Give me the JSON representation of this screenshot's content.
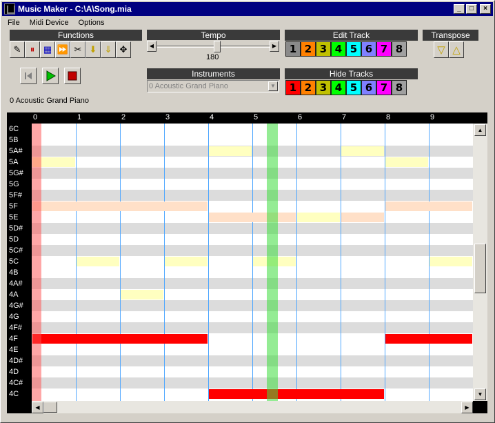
{
  "window": {
    "title": "Music Maker - C:\\A\\Song.mia",
    "minimize": "_",
    "maximize": "□",
    "close": "×"
  },
  "menu": [
    "File",
    "Midi Device",
    "Options"
  ],
  "panels": {
    "functions": "Functions",
    "tempo": "Tempo",
    "edit_track": "Edit Track",
    "transpose": "Transpose",
    "instruments": "Instruments",
    "hide_tracks": "Hide Tracks"
  },
  "function_tools": [
    {
      "name": "pencil-icon",
      "glyph": "✎"
    },
    {
      "name": "split-icon",
      "glyph": "⏸"
    },
    {
      "name": "select-notes-icon",
      "glyph": "▦"
    },
    {
      "name": "fast-forward-icon",
      "glyph": "⏩"
    },
    {
      "name": "cut-icon",
      "glyph": "✂"
    },
    {
      "name": "arrow-down-icon",
      "glyph": "⬇"
    },
    {
      "name": "arrow-down-double-icon",
      "glyph": "⇓"
    },
    {
      "name": "move-icon",
      "glyph": "✥"
    }
  ],
  "tempo": {
    "value": "180",
    "min": 40,
    "max": 300
  },
  "tracks": [
    {
      "label": "1",
      "color": "#8a8a8a"
    },
    {
      "label": "2",
      "color": "#ff8000"
    },
    {
      "label": "3",
      "color": "#c0c000"
    },
    {
      "label": "4",
      "color": "#00ff00"
    },
    {
      "label": "5",
      "color": "#00ffff"
    },
    {
      "label": "6",
      "color": "#8080ff"
    },
    {
      "label": "7",
      "color": "#ff00ff"
    },
    {
      "label": "8",
      "color": "#a0a0a0"
    }
  ],
  "hide_tracks": [
    {
      "label": "1",
      "color": "#ff0000"
    },
    {
      "label": "2",
      "color": "#ff8000"
    },
    {
      "label": "3",
      "color": "#c0c000"
    },
    {
      "label": "4",
      "color": "#00ff00"
    },
    {
      "label": "5",
      "color": "#00ffff"
    },
    {
      "label": "6",
      "color": "#8080ff"
    },
    {
      "label": "7",
      "color": "#ff00ff"
    },
    {
      "label": "8",
      "color": "#a0a0a0"
    }
  ],
  "transpose": {
    "down": "▽",
    "up": "△"
  },
  "instrument": {
    "selected": "0 Acoustic Grand Piano",
    "current_label": "0 Acoustic Grand Piano"
  },
  "ruler": [
    "0",
    "1",
    "2",
    "3",
    "4",
    "5",
    "6",
    "7",
    "8",
    "9"
  ],
  "notes": [
    "6C",
    "5B",
    "5A#",
    "5A",
    "5G#",
    "5G",
    "5F#",
    "5F",
    "5E",
    "5D#",
    "5D",
    "5C#",
    "5C",
    "4B",
    "4A#",
    "4A",
    "4G#",
    "4G",
    "4F#",
    "4F",
    "4E",
    "4D#",
    "4D",
    "4C#",
    "4C"
  ],
  "playhead_beat": 5.3,
  "note_events": [
    {
      "note": "5A",
      "start": 0,
      "end": 1,
      "color": "#ffffc0"
    },
    {
      "note": "5F",
      "start": 0,
      "end": 4,
      "color": "#ffe0c8"
    },
    {
      "note": "5C",
      "start": 1,
      "end": 2,
      "color": "#ffffc0"
    },
    {
      "note": "4A",
      "start": 2,
      "end": 3,
      "color": "#ffffc0"
    },
    {
      "note": "5C",
      "start": 3,
      "end": 4,
      "color": "#ffffc0"
    },
    {
      "note": "4F",
      "start": 0,
      "end": 4,
      "color": "#ff0000"
    },
    {
      "note": "5A#",
      "start": 4,
      "end": 5,
      "color": "#ffffc0"
    },
    {
      "note": "5E",
      "start": 4,
      "end": 6,
      "color": "#ffe0c8"
    },
    {
      "note": "5C",
      "start": 5,
      "end": 6,
      "color": "#ffffc0"
    },
    {
      "note": "5E",
      "start": 6,
      "end": 7,
      "color": "#ffffc0"
    },
    {
      "note": "4C",
      "start": 4,
      "end": 8,
      "color": "#ff0000"
    },
    {
      "note": "5A#",
      "start": 7,
      "end": 8,
      "color": "#ffffc0"
    },
    {
      "note": "5E",
      "start": 7,
      "end": 8,
      "color": "#ffe0c8"
    },
    {
      "note": "5A",
      "start": 8,
      "end": 9,
      "color": "#ffffc0"
    },
    {
      "note": "5F",
      "start": 8,
      "end": 10,
      "color": "#ffe0c8"
    },
    {
      "note": "4F",
      "start": 8,
      "end": 10,
      "color": "#ff0000"
    },
    {
      "note": "5C",
      "start": 9,
      "end": 10,
      "color": "#ffffc0"
    }
  ]
}
